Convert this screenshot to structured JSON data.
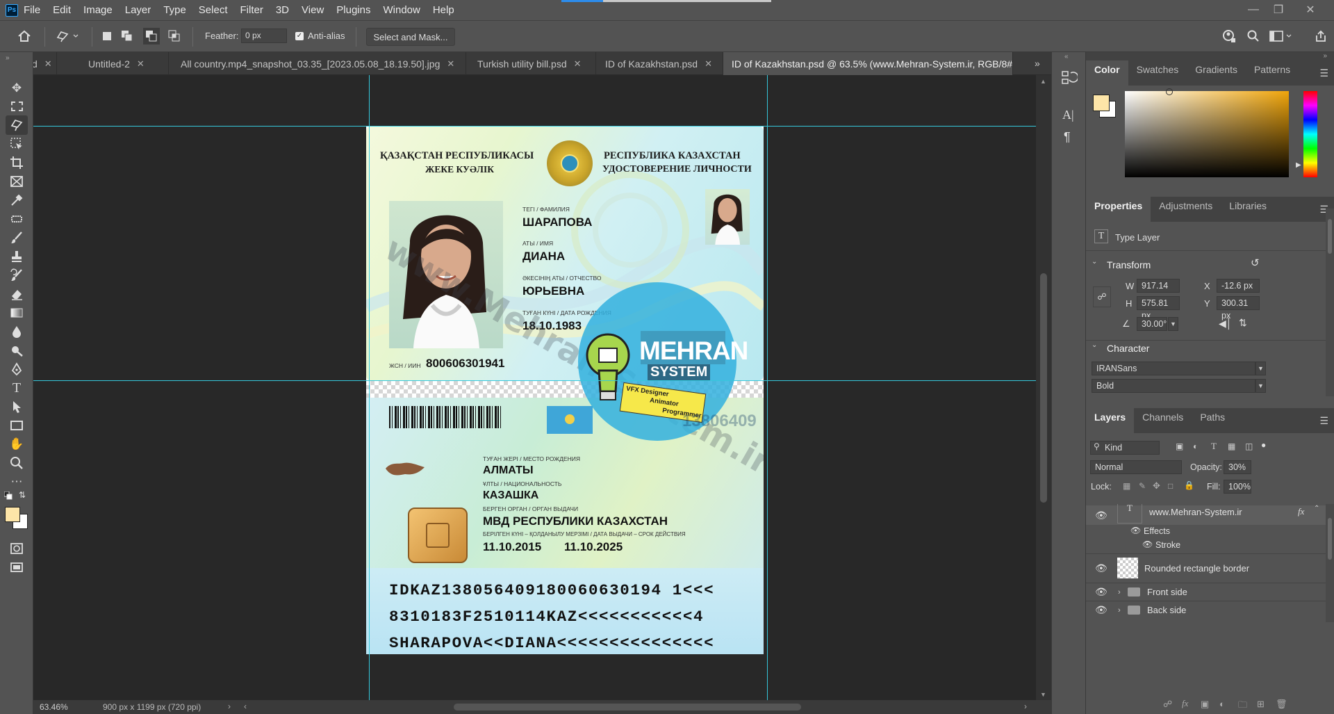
{
  "app": {
    "logo": "Ps"
  },
  "menu": [
    "File",
    "Edit",
    "Image",
    "Layer",
    "Type",
    "Select",
    "Filter",
    "3D",
    "View",
    "Plugins",
    "Window",
    "Help"
  ],
  "options": {
    "feather_label": "Feather:",
    "feather_value": "0 px",
    "antialias_label": "Anti-alias",
    "antialias_checked": true,
    "select_mask": "Select and Mask..."
  },
  "tabs": [
    {
      "label": "d"
    },
    {
      "label": "Untitled-2"
    },
    {
      "label": "All country.mp4_snapshot_03.35_[2023.05.08_18.19.50].jpg"
    },
    {
      "label": "Turkish utility bill.psd"
    },
    {
      "label": "ID of Kazakhstan.psd"
    },
    {
      "label": "ID of Kazakhstan.psd @ 63.5% (www.Mehran-System.ir, RGB/8#) *",
      "active": true
    }
  ],
  "status": {
    "zoom": "63.46%",
    "doc_info": "900 px x 1199 px (720 ppi)"
  },
  "card": {
    "header_kz_1": "ҚАЗАҚСТАН РЕСПУБЛИКАСЫ",
    "header_kz_2": "ЖЕКЕ КУӘЛІК",
    "header_ru_1": "РЕСПУБЛИКА КАЗАХСТАН",
    "header_ru_2": "УДОСТОВЕРЕНИЕ ЛИЧНОСТИ",
    "surname_label": "ТЕГІ / ФАМИЛИЯ",
    "surname": "ШАРАПОВА",
    "name_label": "АТЫ / ИМЯ",
    "name": "ДИАНА",
    "patronymic_label": "ӘКЕСІНІҢ АТЫ / ОТЧЕСТВО",
    "patronymic": "ЮРЬЕВНА",
    "dob_label": "ТУҒАН КҮНІ / ДАТА РОЖДЕНИЯ",
    "dob": "18.10.1983",
    "iin_label": "ЖСН / ИИН",
    "iin": "800606301941",
    "pob_label": "ТУҒАН ЖЕРІ / МЕСТО РОЖДЕНИЯ",
    "pob": "АЛМАТЫ",
    "nat_label": "ҰЛТЫ / НАЦИОНАЛЬНОСТЬ",
    "nat": "КАЗАШКА",
    "authority_label": "БЕРГЕН ОРГАН / ОРГАН ВЫДАЧИ",
    "authority": "МВД РЕСПУБЛИКИ КАЗАХСТАН",
    "dates_label": "БЕРІЛГЕН КҮНІ – ҚОЛДАНЫЛУ МЕРЗІМІ / ДАТА ВЫДАЧИ – СРОК ДЕЙСТВИЯ",
    "issue_date": "11.10.2015",
    "expiry_date": "11.10.2025",
    "mrz_1": "IDKAZ138056409180060630194 1<<<",
    "mrz_2": "8310183F2510114KAZ<<<<<<<<<<<4",
    "mrz_3": "SHARAPOVA<<DIANA<<<<<<<<<<<<<<<",
    "watermark": "www.Mehran-System.ir",
    "badge_title": "MEHRAN",
    "badge_sub": "SYSTEM",
    "badge_roles": [
      "VFX Designer",
      "Animator",
      "Programmer"
    ],
    "badge_number": "13806409"
  },
  "panels": {
    "color_tabs": [
      "Color",
      "Swatches",
      "Gradients",
      "Patterns"
    ],
    "props_tabs": [
      "Properties",
      "Adjustments",
      "Libraries"
    ],
    "layer_type": "Type Layer",
    "transform_title": "Transform",
    "w_label": "W",
    "w": "917.14 px",
    "x_label": "X",
    "x": "-12.6 px",
    "h_label": "H",
    "h": "575.81 px",
    "y_label": "Y",
    "y": "300.31 px",
    "angle": "30.00°",
    "character_title": "Character",
    "font_family": "IRANSans",
    "font_style": "Bold",
    "layers_tabs": [
      "Layers",
      "Channels",
      "Paths"
    ],
    "kind": "Kind",
    "blend_mode": "Normal",
    "opacity_label": "Opacity:",
    "opacity": "30%",
    "lock_label": "Lock:",
    "fill_label": "Fill:",
    "fill": "100%",
    "layers": [
      {
        "name": "www.Mehran-System.ir",
        "fx": "fx"
      },
      {
        "name": "Effects"
      },
      {
        "name": "Stroke"
      },
      {
        "name": "Rounded rectangle border"
      },
      {
        "name": "Front side"
      },
      {
        "name": "Back side"
      }
    ]
  },
  "colors": {
    "foreground": "#fde5a8",
    "background": "#ffffff",
    "guide": "#35c8dc",
    "accent": "#31a8ff"
  }
}
